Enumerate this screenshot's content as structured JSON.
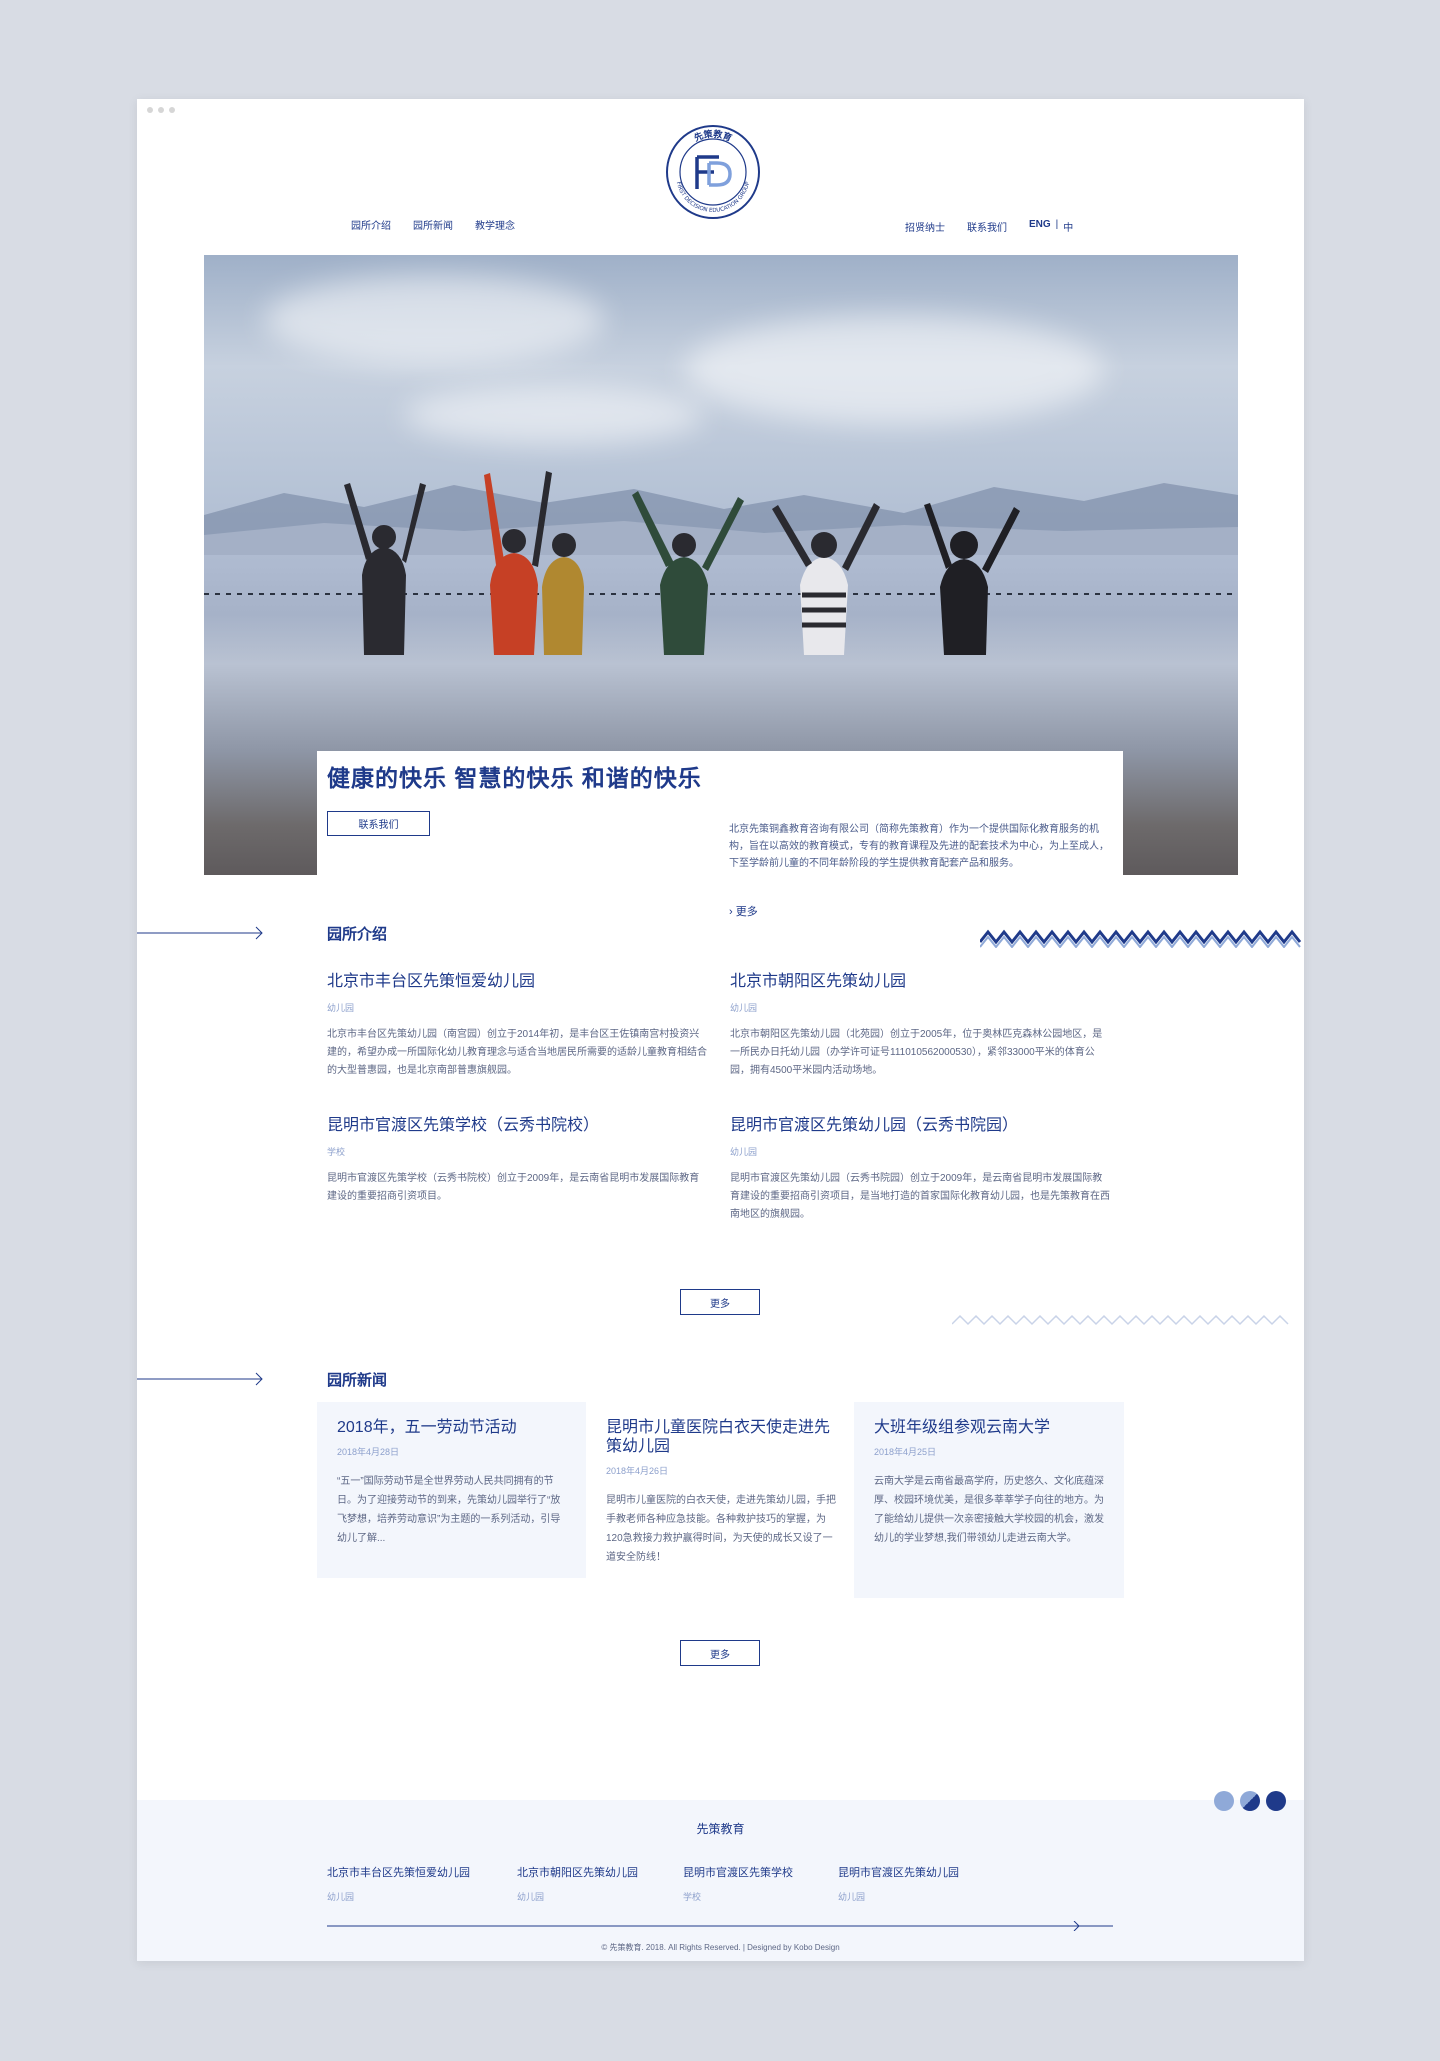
{
  "header": {
    "nav_left": [
      "园所介绍",
      "园所新闻",
      "教学理念"
    ],
    "nav_right": [
      "招贤纳士",
      "联系我们"
    ],
    "lang_en": "ENG",
    "lang_sep": "|",
    "lang_zh": "中",
    "logo_top": "先策教育",
    "logo_ring": "FIRST DECISION EDUCATION GROUP"
  },
  "hero": {
    "title": "健康的快乐 智慧的快乐 和谐的快乐",
    "contact_button": "联系我们",
    "description": "北京先策铜鑫教育咨询有限公司（简称先策教育）作为一个提供国际化教育服务的机构，旨在以高效的教育模式，专有的教育课程及先进的配套技术为中心，为上至成人，下至学龄前儿童的不同年龄阶段的学生提供教育配套产品和服务。",
    "more": "更多"
  },
  "campus_section": {
    "title": "园所介绍",
    "items": [
      {
        "name": "北京市丰台区先策恒爱幼儿园",
        "tag": "幼儿园",
        "desc": "北京市丰台区先策幼儿园（南宫园）创立于2014年初，是丰台区王佐镇南宫村投资兴建的，希望办成一所国际化幼儿教育理念与适合当地居民所需要的适龄儿童教育相结合的大型普惠园，也是北京南部普惠旗舰园。"
      },
      {
        "name": "北京市朝阳区先策幼儿园",
        "tag": "幼儿园",
        "desc": "北京市朝阳区先策幼儿园（北苑园）创立于2005年，位于奥林匹克森林公园地区，是一所民办日托幼儿园（办学许可证号111010562000530），紧邻33000平米的体育公园，拥有4500平米园内活动场地。"
      },
      {
        "name": "昆明市官渡区先策学校（云秀书院校）",
        "tag": "学校",
        "desc": "昆明市官渡区先策学校（云秀书院校）创立于2009年，是云南省昆明市发展国际教育建设的重要招商引资项目。"
      },
      {
        "name": "昆明市官渡区先策幼儿园（云秀书院园）",
        "tag": "幼儿园",
        "desc": "昆明市官渡区先策幼儿园（云秀书院园）创立于2009年，是云南省昆明市发展国际教育建设的重要招商引资项目，是当地打造的首家国际化教育幼儿园，也是先策教育在西南地区的旗舰园。"
      }
    ],
    "more": "更多"
  },
  "news_section": {
    "title": "园所新闻",
    "items": [
      {
        "title": "2018年，五一劳动节活动",
        "date": "2018年4月28日",
        "desc": "“五一”国际劳动节是全世界劳动人民共同拥有的节日。为了迎接劳动节的到来，先策幼儿园举行了“放飞梦想，培养劳动意识”为主题的一系列活动，引导幼儿了解..."
      },
      {
        "title": "昆明市儿童医院白衣天使走进先策幼儿园",
        "date": "2018年4月26日",
        "desc": "昆明市儿童医院的白衣天使，走进先策幼儿园，手把手教老师各种应急技能。各种救护技巧的掌握，为120急救接力救护赢得时间，为天使的成长又设了一道安全防线！"
      },
      {
        "title": "大班年级组参观云南大学",
        "date": "2018年4月25日",
        "desc": "云南大学是云南省最高学府，历史悠久、文化底蕴深厚、校园环境优美，是很多莘莘学子向往的地方。为了能给幼儿提供一次亲密接触大学校园的机会，激发幼儿的学业梦想,我们带领幼儿走进云南大学。"
      }
    ],
    "more": "更多"
  },
  "footer": {
    "title": "先策教育",
    "items": [
      {
        "name": "北京市丰台区先策恒爱幼儿园",
        "sub": "幼儿园"
      },
      {
        "name": "北京市朝阳区先策幼儿园",
        "sub": "幼儿园"
      },
      {
        "name": "昆明市官渡区先策学校",
        "sub": "学校"
      },
      {
        "name": "昆明市官渡区先策幼儿园",
        "sub": "幼儿园"
      }
    ],
    "copyright": "© 先策教育. 2018. All Rights Reserved. | Designed by Kobo Design"
  },
  "colors": {
    "primary": "#1f3a8a",
    "light_bg": "#f3f6fc",
    "circle_1": "#8fa9d8",
    "circle_2": "#3a5aa8",
    "circle_3": "#1f3a8a"
  }
}
